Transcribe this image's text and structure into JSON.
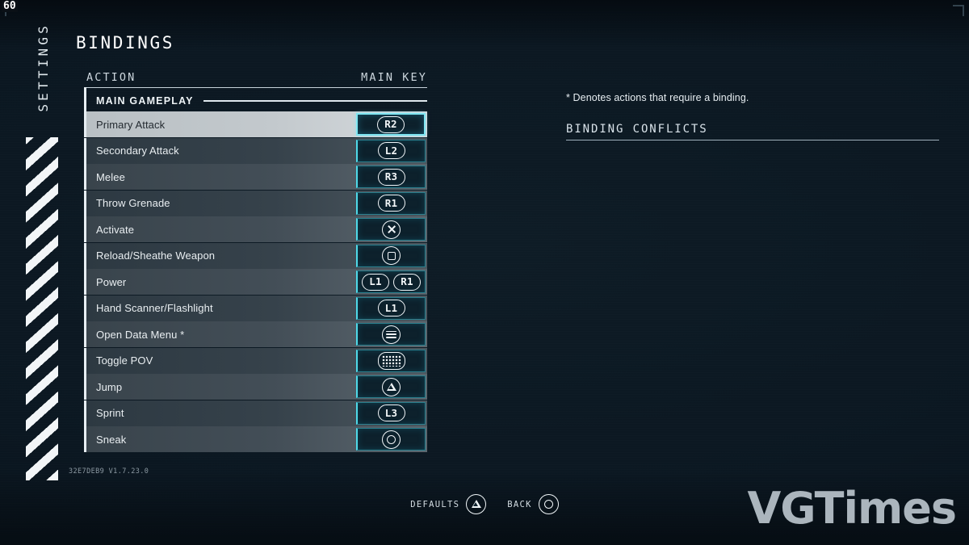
{
  "hud": {
    "fps": "60",
    "version": "32E7DEB9 V1.7.23.0"
  },
  "sidebar": {
    "label": "SETTINGS"
  },
  "header": {
    "title": "BINDINGS"
  },
  "table": {
    "col_action": "ACTION",
    "col_main_key": "MAIN KEY",
    "group_label": "MAIN GAMEPLAY",
    "rows": [
      {
        "action": "Primary Attack",
        "keys": [
          "R2"
        ],
        "selected": true
      },
      {
        "action": "Secondary Attack",
        "keys": [
          "L2"
        ],
        "selected": false
      },
      {
        "action": "Melee",
        "keys": [
          "R3"
        ],
        "selected": false
      },
      {
        "action": "Throw Grenade",
        "keys": [
          "R1"
        ],
        "selected": false
      },
      {
        "action": "Activate",
        "keys": [
          "cross"
        ],
        "selected": false
      },
      {
        "action": "Reload/Sheathe Weapon",
        "keys": [
          "square"
        ],
        "selected": false
      },
      {
        "action": "Power",
        "keys": [
          "L1",
          "R1"
        ],
        "selected": false
      },
      {
        "action": "Hand Scanner/Flashlight",
        "keys": [
          "L1"
        ],
        "selected": false
      },
      {
        "action": "Open Data Menu *",
        "keys": [
          "options"
        ],
        "selected": false
      },
      {
        "action": "Toggle POV",
        "keys": [
          "touchpad"
        ],
        "selected": false
      },
      {
        "action": "Jump",
        "keys": [
          "triangle"
        ],
        "selected": false
      },
      {
        "action": "Sprint",
        "keys": [
          "L3"
        ],
        "selected": false
      },
      {
        "action": "Sneak",
        "keys": [
          "circle"
        ],
        "selected": false
      }
    ]
  },
  "info": {
    "denotes_note": "* Denotes actions that require a binding.",
    "conflicts_header": "BINDING CONFLICTS"
  },
  "prompts": [
    {
      "label": "DEFAULTS",
      "glyph": "triangle"
    },
    {
      "label": "BACK",
      "glyph": "circle"
    }
  ],
  "watermark": {
    "text": "VGTimes"
  },
  "colors": {
    "background": "#0b1720",
    "accent_cyan": "#4fd9e8",
    "key_box_bg": "#0d212c",
    "row_bg": "#39444c",
    "row_selected_bg": "#c3c9cd",
    "text_primary": "#e9eef1"
  }
}
